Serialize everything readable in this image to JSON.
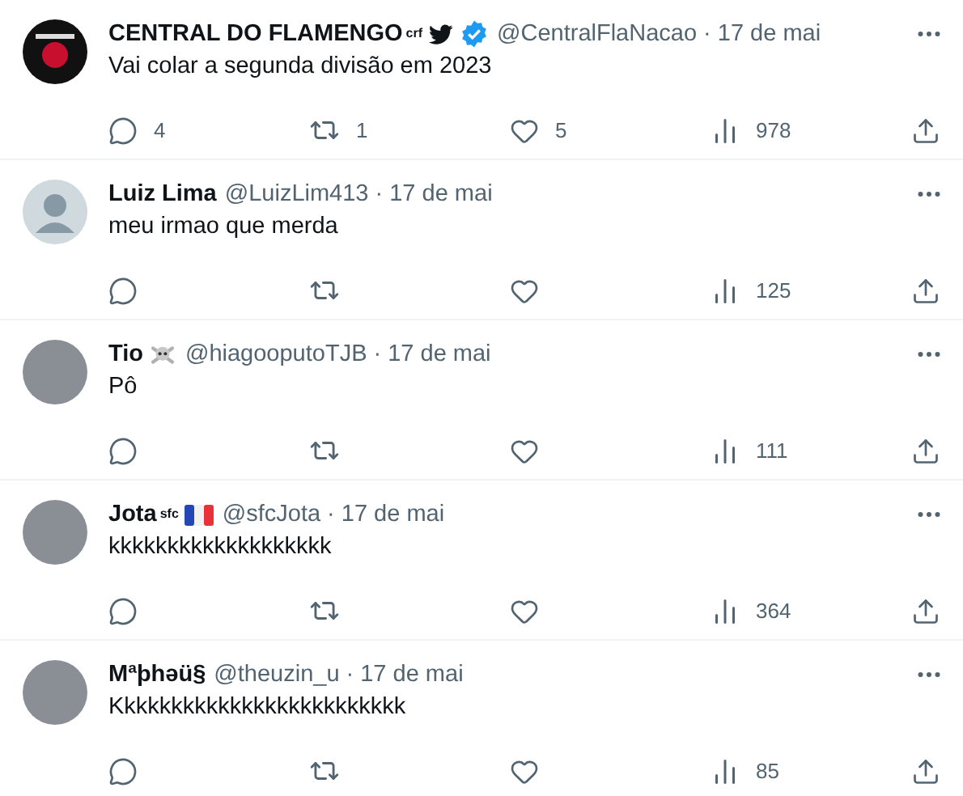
{
  "tweets": [
    {
      "avatar": {
        "kind": "logo"
      },
      "name": "CENTRAL DO FLAMENGO",
      "name_suffix": "crf",
      "badges": [
        {
          "kind": "bird"
        },
        {
          "kind": "verified"
        }
      ],
      "handle": "@CentralFlaNacao",
      "separator": "·",
      "date": "17 de mai",
      "text": "Vai colar a segunda divisão em 2023",
      "replies": "4",
      "retweets": "1",
      "likes": "5",
      "views": "978"
    },
    {
      "avatar": {
        "kind": "default"
      },
      "name": "Luiz Lima",
      "handle": "@LuizLim413",
      "separator": "·",
      "date": "17 de mai",
      "text": "meu irmao que merda",
      "views": "125"
    },
    {
      "avatar": {
        "kind": "photo"
      },
      "name": "Tio",
      "badges": [
        {
          "kind": "skull"
        }
      ],
      "handle": "@hiagooputoTJB",
      "separator": "·",
      "date": "17 de mai",
      "text": "Pô",
      "views": "111"
    },
    {
      "avatar": {
        "kind": "photo"
      },
      "name": "Jota",
      "name_suffix": "sfc",
      "badges": [
        {
          "kind": "flag"
        }
      ],
      "handle": "@sfcJota",
      "separator": "·",
      "date": "17 de mai",
      "text": "kkkkkkkkkkkkkkkkkkk",
      "views": "364"
    },
    {
      "avatar": {
        "kind": "photo"
      },
      "name": "Mªþhəü§",
      "handle": "@theuzin_u",
      "separator": "·",
      "date": "17 de mai",
      "text": "Kkkkkkkkkkkkkkkkkkkkkkkkk",
      "views": "85"
    }
  ]
}
